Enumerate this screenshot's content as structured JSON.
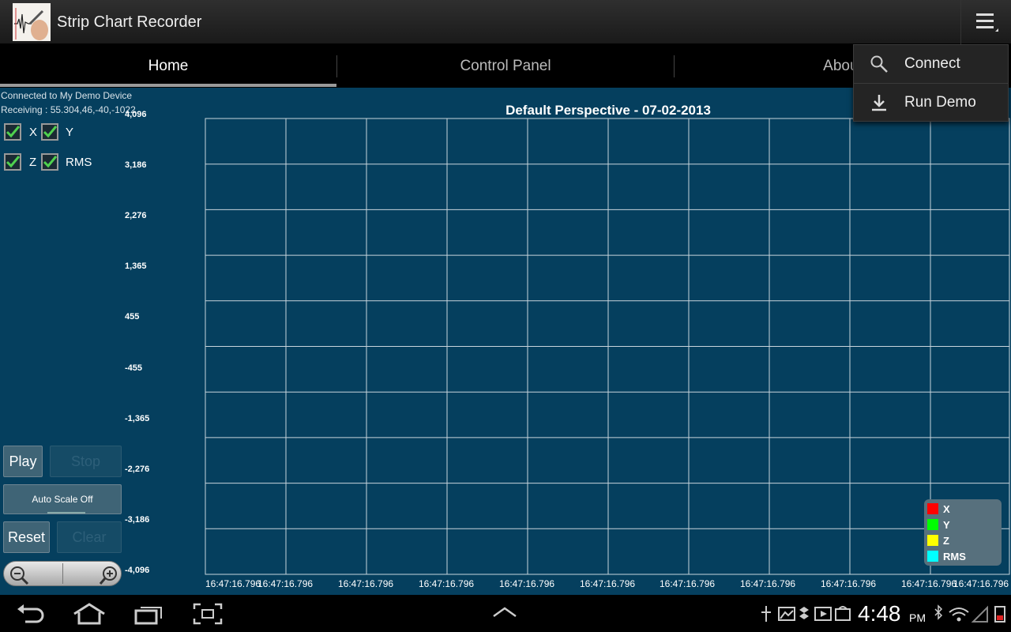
{
  "app": {
    "title": "Strip Chart Recorder"
  },
  "tabs": [
    {
      "label": "Home",
      "active": true
    },
    {
      "label": "Control Panel",
      "active": false
    },
    {
      "label": "About",
      "active": false
    }
  ],
  "status": {
    "connected": "Connected to My Demo Device",
    "receiving": "Receiving : 55.304,46,-40,-1022"
  },
  "channels": [
    {
      "label": "X",
      "checked": true
    },
    {
      "label": "Y",
      "checked": true
    },
    {
      "label": "Z",
      "checked": true
    },
    {
      "label": "RMS",
      "checked": true
    }
  ],
  "controls": {
    "play": "Play",
    "stop": "Stop",
    "auto_scale": "Auto Scale Off",
    "reset": "Reset",
    "clear": "Clear"
  },
  "menu": [
    {
      "label": "Connect",
      "icon": "search-icon"
    },
    {
      "label": "Run Demo",
      "icon": "download-icon"
    }
  ],
  "chart_data": {
    "type": "line",
    "title": "Default Perspective - 07-02-2013",
    "y_ticks": [
      "4,096",
      "3,186",
      "2,276",
      "1,365",
      "455",
      "-455",
      "-1,365",
      "-2,276",
      "-3,186",
      "-4,096"
    ],
    "ylim": [
      -4096,
      4096
    ],
    "x_ticks": [
      "16:47:16.796",
      "16:47:16.796",
      "16:47:16.796",
      "16:47:16.796",
      "16:47:16.796",
      "16:47:16.796",
      "16:47:16.796",
      "16:47:16.796",
      "16:47:16.796",
      "16:47:16.796",
      "16:47:16.796",
      "16:47:16.796"
    ],
    "grid": true,
    "legend_position": "bottom-right",
    "series": [
      {
        "name": "X",
        "color": "#ff0000",
        "values": []
      },
      {
        "name": "Y",
        "color": "#00ff00",
        "values": []
      },
      {
        "name": "Z",
        "color": "#ffff00",
        "values": []
      },
      {
        "name": "RMS",
        "color": "#00ffff",
        "values": []
      }
    ]
  },
  "system": {
    "time": "4:48",
    "ampm": "PM"
  }
}
